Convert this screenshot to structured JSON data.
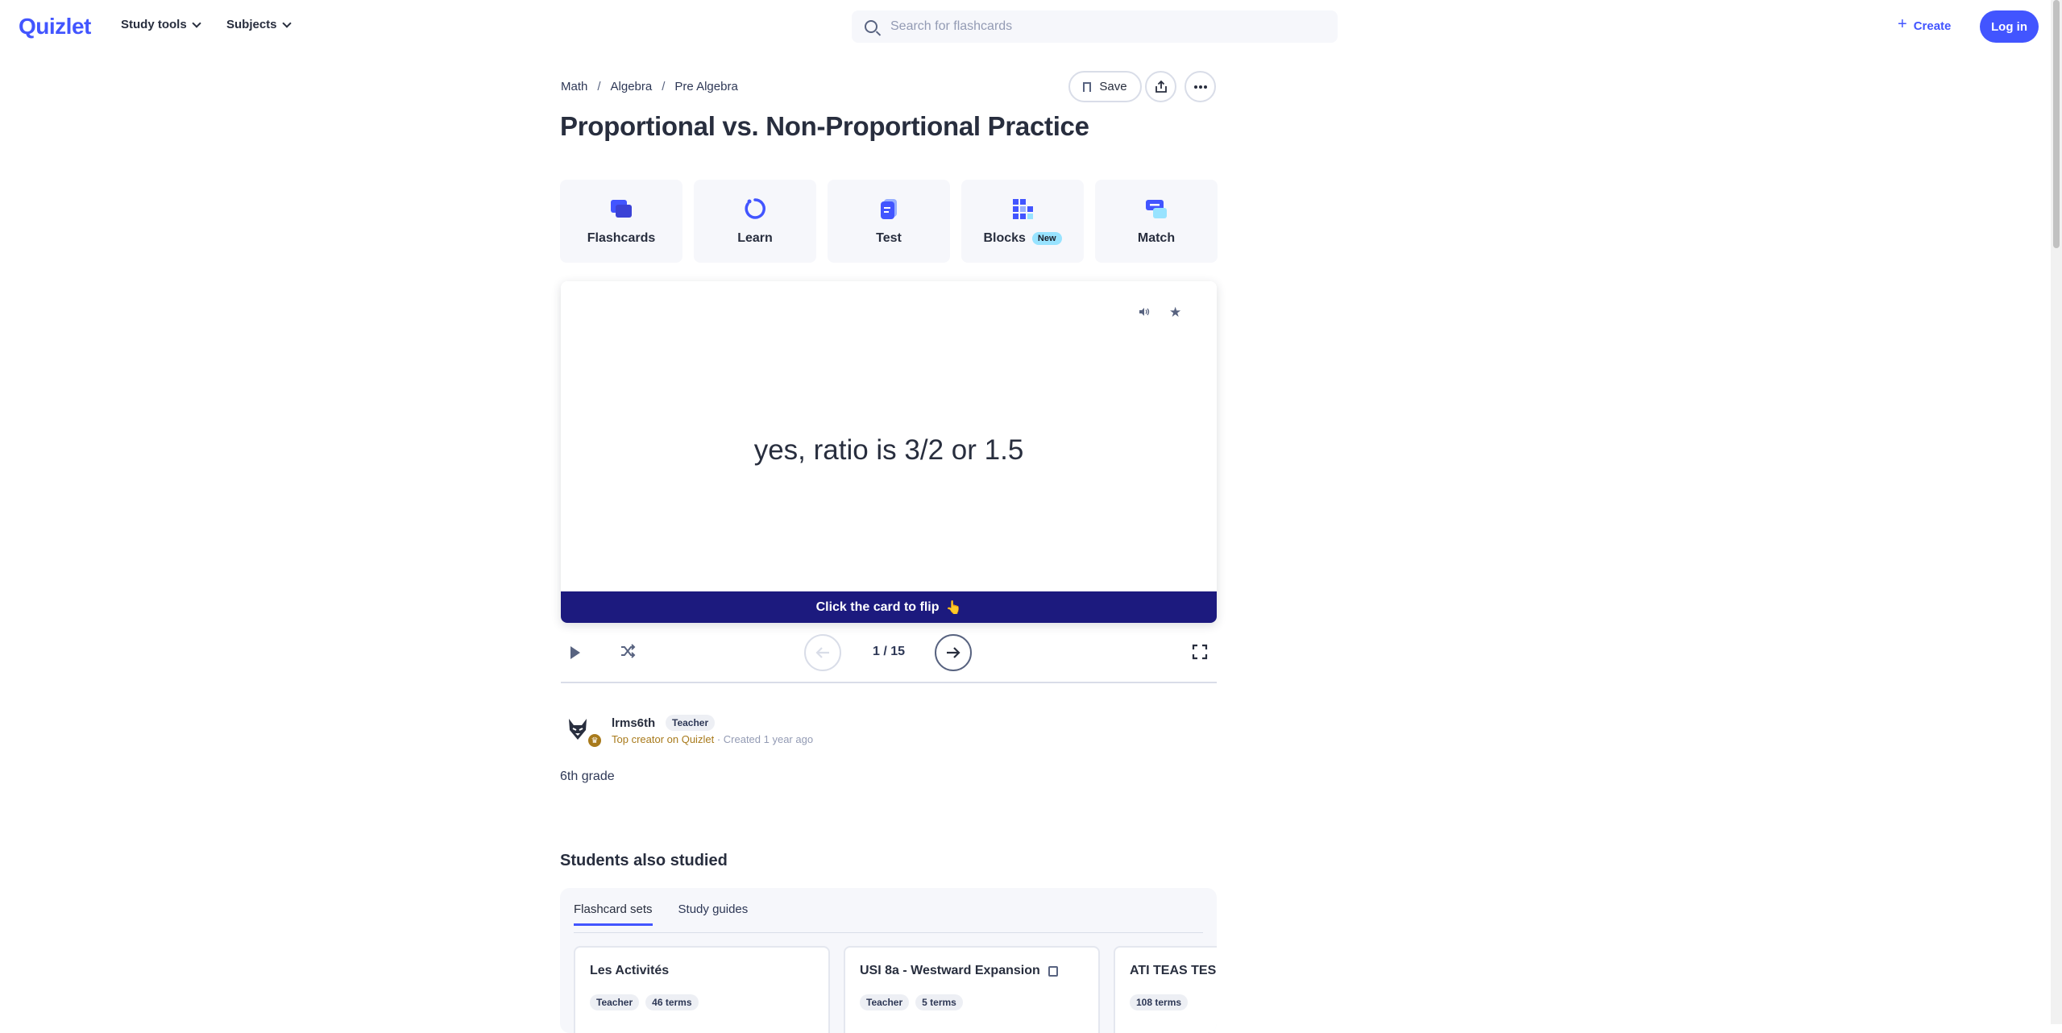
{
  "header": {
    "logo": "Quizlet",
    "study_tools": "Study tools",
    "subjects": "Subjects",
    "search_placeholder": "Search for flashcards",
    "create": "Create",
    "login": "Log in"
  },
  "breadcrumbs": [
    "Math",
    "Algebra",
    "Pre Algebra"
  ],
  "save_label": "Save",
  "title": "Proportional vs. Non-Proportional Practice",
  "modes": [
    {
      "label": "Flashcards",
      "icon": "flashcards-icon"
    },
    {
      "label": "Learn",
      "icon": "learn-icon"
    },
    {
      "label": "Test",
      "icon": "test-icon"
    },
    {
      "label": "Blocks",
      "icon": "blocks-icon",
      "badge": "New"
    },
    {
      "label": "Match",
      "icon": "match-icon"
    }
  ],
  "card": {
    "text": "yes, ratio is 3/2 or 1.5",
    "flip_hint": "Click the card to flip",
    "flip_emoji": "👆"
  },
  "controls": {
    "counter": "1 / 15"
  },
  "author": {
    "name": "lrms6th",
    "role": "Teacher",
    "top_creator": "Top creator on Quizlet",
    "created": "Created 1 year ago"
  },
  "description": "6th grade",
  "also_studied": {
    "heading": "Students also studied",
    "tabs": [
      "Flashcard sets",
      "Study guides"
    ],
    "sets": [
      {
        "title": "Les Activités",
        "tags": [
          "Teacher",
          "46 terms"
        ]
      },
      {
        "title": "USI 8a - Westward Expansion",
        "tags": [
          "Teacher",
          "5 terms"
        ]
      },
      {
        "title": "ATI TEAS TES",
        "tags": [
          "108 terms"
        ]
      }
    ]
  },
  "colors": {
    "brand": "#4255ff",
    "flipbar": "#1c1a7e",
    "badge_new": "#98e3ff",
    "top_creator": "#a87a1b"
  }
}
